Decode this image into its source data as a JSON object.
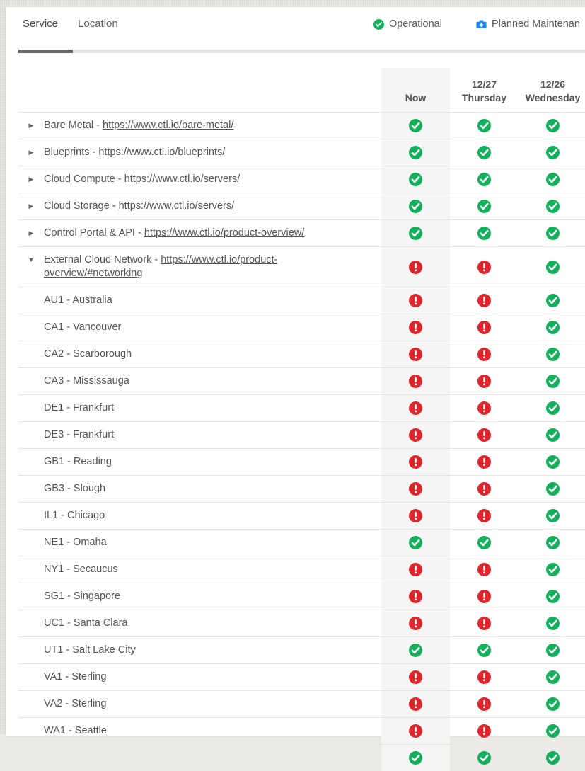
{
  "tabs": [
    {
      "label": "Service",
      "active": true
    },
    {
      "label": "Location",
      "active": false
    }
  ],
  "legend": [
    {
      "label": "Operational",
      "icon": "check-circle-icon",
      "color": "#12b05a"
    },
    {
      "label": "Planned Maintenan",
      "icon": "medical-kit-icon",
      "color": "#1e88e5"
    }
  ],
  "columns": [
    {
      "date": "",
      "day": "Now",
      "highlighted": true
    },
    {
      "date": "12/27",
      "day": "Thursday",
      "highlighted": false
    },
    {
      "date": "12/26",
      "day": "Wednesday",
      "highlighted": false
    }
  ],
  "colors": {
    "operational": "#12b05a",
    "issue": "#e0242b",
    "maintenance": "#1e88e5",
    "text": "#555555",
    "highlight_bg": "#f5f5f5",
    "tab_indicator": "#686868"
  },
  "rows": [
    {
      "type": "service",
      "expanded": false,
      "name": "Bare Metal",
      "separator": " - ",
      "link": "https://www.ctl.io/bare-metal/",
      "statuses": [
        "ok",
        "ok",
        "ok"
      ]
    },
    {
      "type": "service",
      "expanded": false,
      "name": "Blueprints",
      "separator": " - ",
      "link": "https://www.ctl.io/blueprints/",
      "statuses": [
        "ok",
        "ok",
        "ok"
      ]
    },
    {
      "type": "service",
      "expanded": false,
      "name": "Cloud Compute",
      "separator": " - ",
      "link": "https://www.ctl.io/servers/",
      "statuses": [
        "ok",
        "ok",
        "ok"
      ]
    },
    {
      "type": "service",
      "expanded": false,
      "name": "Cloud Storage",
      "separator": " - ",
      "link": "https://www.ctl.io/servers/",
      "statuses": [
        "ok",
        "ok",
        "ok"
      ]
    },
    {
      "type": "service",
      "expanded": false,
      "name": "Control Portal & API",
      "separator": " - ",
      "link": "https://www.ctl.io/product-overview/",
      "statuses": [
        "ok",
        "ok",
        "ok"
      ]
    },
    {
      "type": "service",
      "expanded": true,
      "name": "External Cloud Network",
      "separator": " - ",
      "link": "https://www.ctl.io/product-overview/#networking",
      "statuses": [
        "issue",
        "issue",
        "ok"
      ]
    },
    {
      "type": "location",
      "name": "AU1 - Australia",
      "statuses": [
        "issue",
        "issue",
        "ok"
      ]
    },
    {
      "type": "location",
      "name": "CA1 - Vancouver",
      "statuses": [
        "issue",
        "issue",
        "ok"
      ]
    },
    {
      "type": "location",
      "name": "CA2 - Scarborough",
      "statuses": [
        "issue",
        "issue",
        "ok"
      ]
    },
    {
      "type": "location",
      "name": "CA3 - Mississauga",
      "statuses": [
        "issue",
        "issue",
        "ok"
      ]
    },
    {
      "type": "location",
      "name": "DE1 - Frankfurt",
      "statuses": [
        "issue",
        "issue",
        "ok"
      ]
    },
    {
      "type": "location",
      "name": "DE3 - Frankfurt",
      "statuses": [
        "issue",
        "issue",
        "ok"
      ]
    },
    {
      "type": "location",
      "name": "GB1 - Reading",
      "statuses": [
        "issue",
        "issue",
        "ok"
      ]
    },
    {
      "type": "location",
      "name": "GB3 - Slough",
      "statuses": [
        "issue",
        "issue",
        "ok"
      ]
    },
    {
      "type": "location",
      "name": "IL1 - Chicago",
      "statuses": [
        "issue",
        "issue",
        "ok"
      ]
    },
    {
      "type": "location",
      "name": "NE1 - Omaha",
      "statuses": [
        "ok",
        "ok",
        "ok"
      ]
    },
    {
      "type": "location",
      "name": "NY1 - Secaucus",
      "statuses": [
        "issue",
        "issue",
        "ok"
      ]
    },
    {
      "type": "location",
      "name": "SG1 - Singapore",
      "statuses": [
        "issue",
        "issue",
        "ok"
      ]
    },
    {
      "type": "location",
      "name": "UC1 - Santa Clara",
      "statuses": [
        "issue",
        "issue",
        "ok"
      ]
    },
    {
      "type": "location",
      "name": "UT1 - Salt Lake City",
      "statuses": [
        "ok",
        "ok",
        "ok"
      ]
    },
    {
      "type": "location",
      "name": "VA1 - Sterling",
      "statuses": [
        "issue",
        "issue",
        "ok"
      ]
    },
    {
      "type": "location",
      "name": "VA2 - Sterling",
      "statuses": [
        "issue",
        "issue",
        "ok"
      ]
    },
    {
      "type": "location",
      "name": "WA1 - Seattle",
      "statuses": [
        "issue",
        "issue",
        "ok"
      ]
    },
    {
      "type": "location",
      "name": "",
      "partial": true,
      "statuses": [
        "ok",
        "ok",
        "ok"
      ]
    }
  ]
}
